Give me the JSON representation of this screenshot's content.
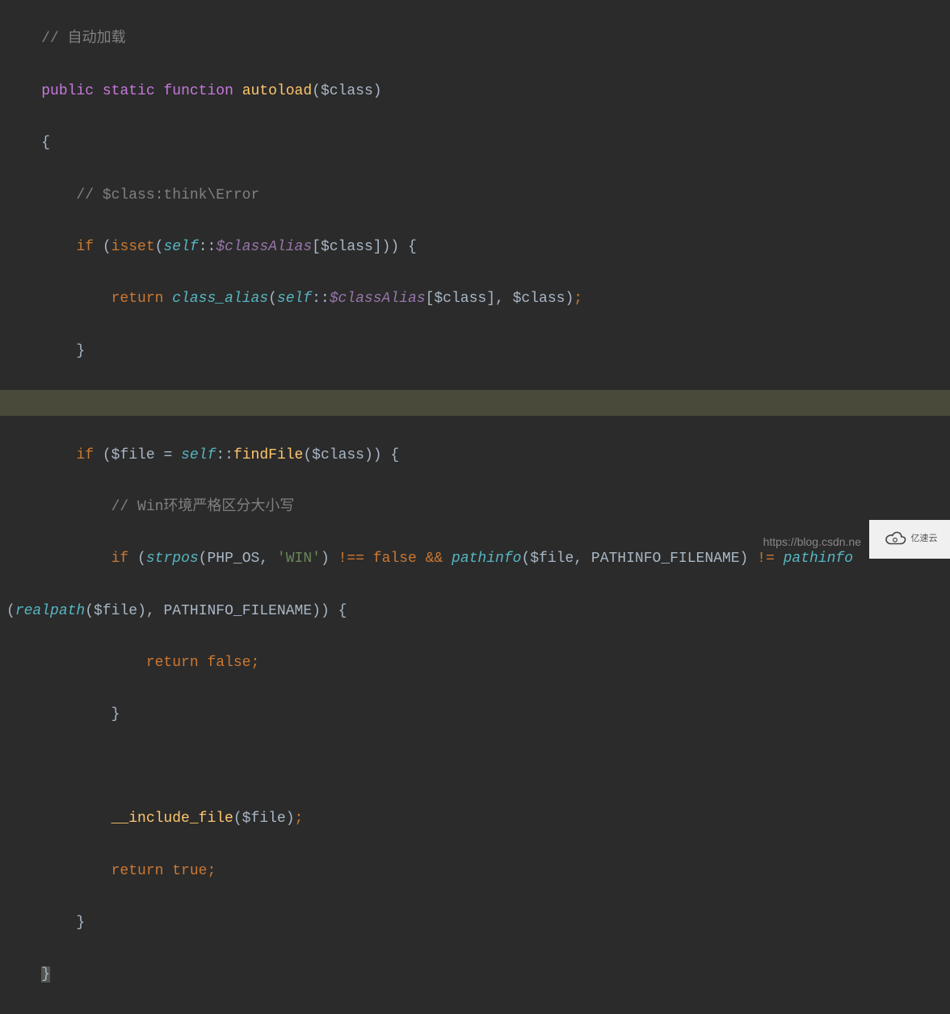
{
  "code": {
    "comment_autoload": "// 自动加载",
    "public": "public",
    "static": "static",
    "function": "function",
    "autoload": "autoload",
    "class_param": "$class",
    "open_brace": "{",
    "comment_class": "// $class:think\\Error",
    "if": "if",
    "isset": "isset",
    "self": "self",
    "double_colon": "::",
    "classAlias": "$classAlias",
    "return": " return",
    "class_alias_fn": "class_alias",
    "close_brace": "}",
    "file_var": "$file",
    "assign": "=",
    "findFile": "findFile",
    "comment_win": "// Win环境严格区分大小写",
    "strpos": "strpos",
    "php_os": "PHP_OS",
    "win_str": "'WIN'",
    "not_eq": "!==",
    "false": "false",
    "amp": "&&",
    "pathinfo": "pathinfo",
    "pathinfo_filename": "PATHINFO_FILENAME",
    "ne": "!=",
    "realpath": "realpath",
    "return2": "return",
    "include_file": "__include_file",
    "true": "true",
    "comma": ",",
    "semi": ";"
  },
  "watermark": "https://blog.csdn.ne",
  "logo_text": "亿速云"
}
